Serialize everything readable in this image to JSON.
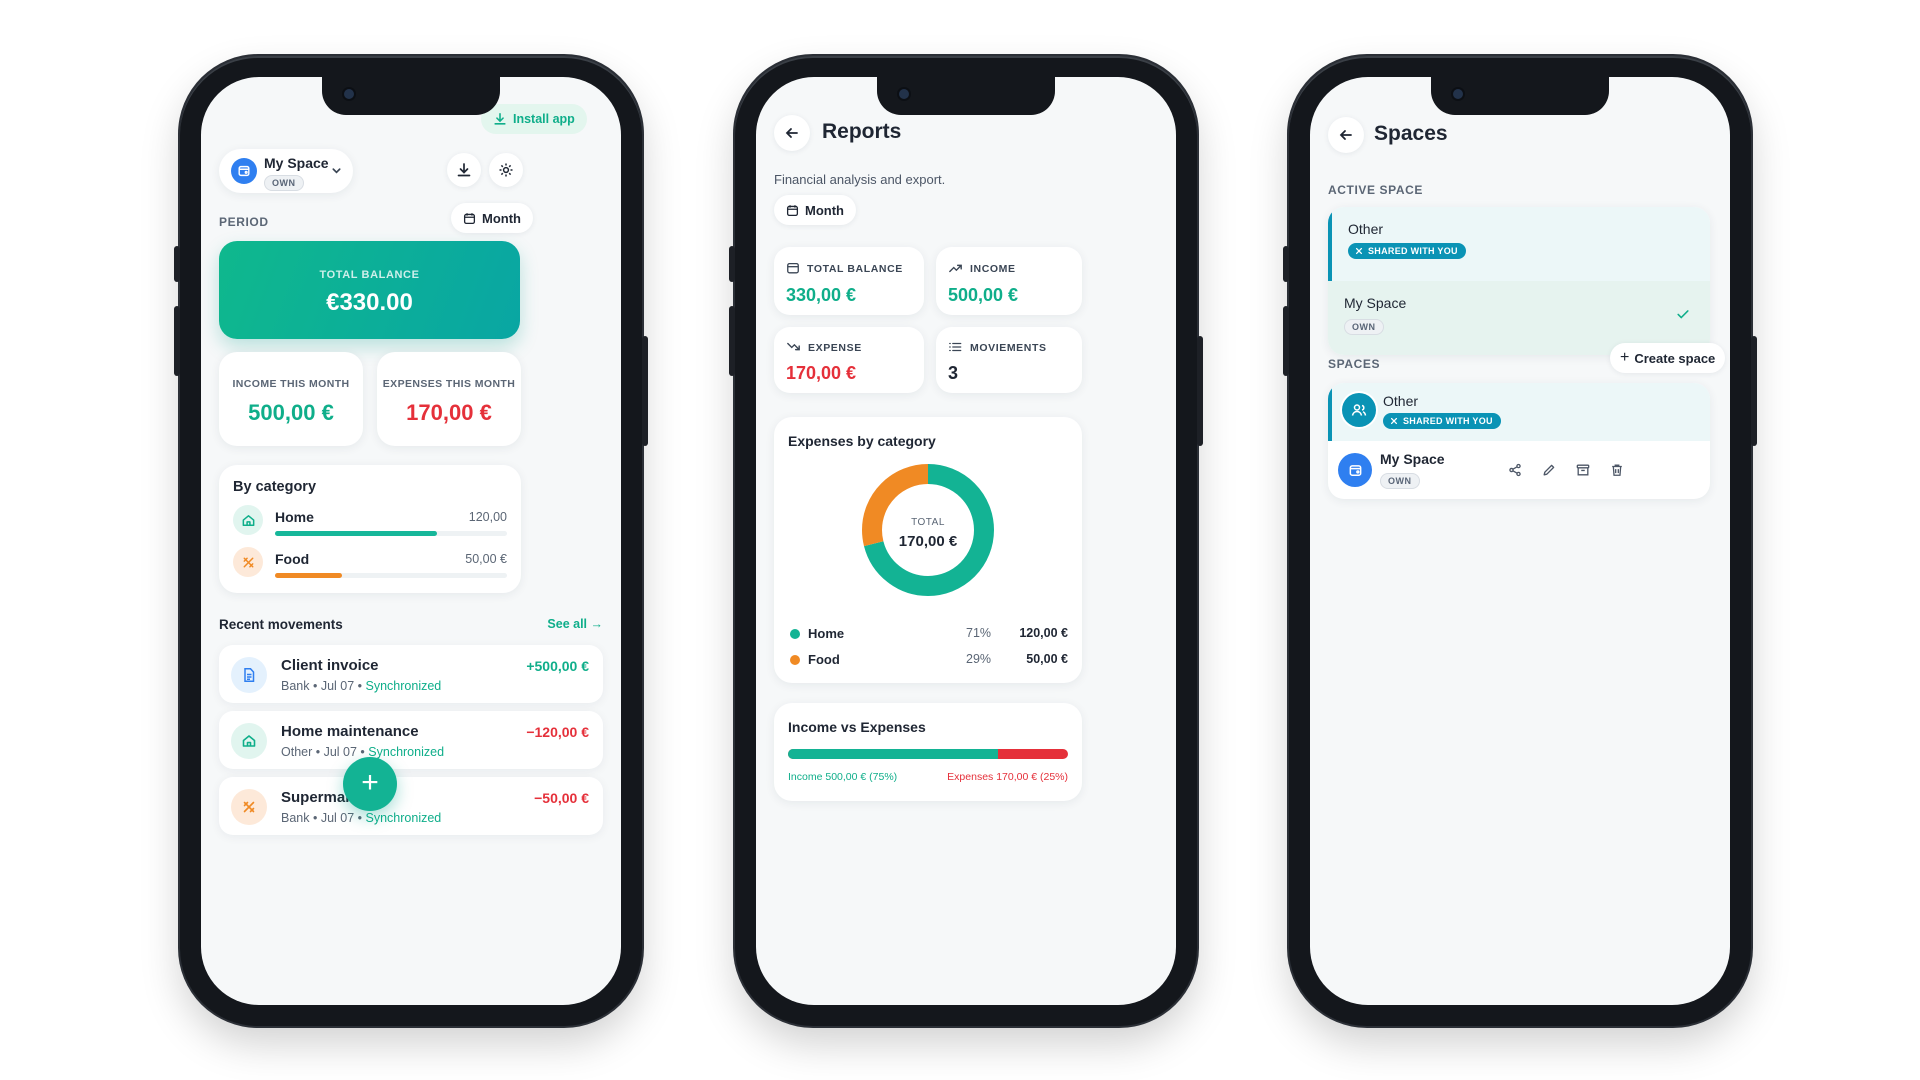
{
  "colors": {
    "accent": "#0fae8a",
    "expense": "#e5303a",
    "food": "#f08a24",
    "brand_blue": "#2f7ff0",
    "shared": "#0a93b5"
  },
  "home": {
    "install_app": "Install app",
    "space_name": "My Space",
    "space_tag": "OWN",
    "period_label": "PERIOD",
    "period_value": "Month",
    "total_balance_label": "TOTAL BALANCE",
    "total_balance_value": "€330.00",
    "income_label": "INCOME THIS MONTH",
    "income_value": "500,00 €",
    "expenses_label": "EXPENSES THIS MONTH",
    "expenses_value": "170,00 €",
    "by_category_title": "By category",
    "categories": [
      {
        "name": "Home",
        "amount": "120,00",
        "progress": 0.7,
        "icon": "home-icon"
      },
      {
        "name": "Food",
        "amount": "50,00 €",
        "progress": 0.29,
        "icon": "utensils-icon"
      }
    ],
    "recent_title": "Recent movements",
    "see_all": "See all →",
    "movements": [
      {
        "title": "Client invoice",
        "source": "Bank",
        "date": "Jul 07",
        "status": "Synchronized",
        "amount": "+500,00 €",
        "icon": "document-icon"
      },
      {
        "title": "Home maintenance",
        "source": "Other",
        "date": "Jul 07",
        "status": "Synchronized",
        "amount": "−120,00 €",
        "icon": "home-icon"
      },
      {
        "title": "Supermarket",
        "source": "Bank",
        "date": "Jul 07",
        "status": "Synchronized",
        "amount": "−50,00 €",
        "icon": "utensils-icon"
      }
    ],
    "fab_label": "+"
  },
  "reports": {
    "title": "Reports",
    "subtitle": "Financial analysis and export.",
    "period_value": "Month",
    "stats": [
      {
        "label": "TOTAL BALANCE",
        "value": "330,00 €",
        "icon": "wallet-icon"
      },
      {
        "label": "INCOME",
        "value": "500,00 €",
        "icon": "trend-up-icon"
      },
      {
        "label": "EXPENSE",
        "value": "170,00 €",
        "icon": "trend-down-icon"
      },
      {
        "label": "MOVIEMENTS",
        "value": "3",
        "icon": "list-icon"
      }
    ],
    "expenses_title": "Expenses by category",
    "donut_total_label": "TOTAL",
    "donut_total_value": "170,00 €",
    "legend": [
      {
        "name": "Home",
        "percent": "71%",
        "amount": "120,00 €",
        "share": 71
      },
      {
        "name": "Food",
        "percent": "29%",
        "amount": "50,00 €",
        "share": 29
      }
    ],
    "ivse_title": "Income vs Expenses",
    "income_share": 75,
    "income_caption": "Income 500,00 € (75%)",
    "expenses_caption": "Expenses 170,00 € (25%)"
  },
  "spaces": {
    "title": "Spaces",
    "active_label": "ACTIVE SPACE",
    "active_items": [
      {
        "name": "Other",
        "tag": "SHARED WITH YOU"
      },
      {
        "name": "My Space",
        "tag": "OWN"
      }
    ],
    "spaces_label": "SPACES",
    "create_space": "Create space",
    "list": [
      {
        "name": "Other",
        "tag": "SHARED WITH YOU"
      },
      {
        "name": "My Space",
        "tag": "OWN"
      }
    ]
  }
}
